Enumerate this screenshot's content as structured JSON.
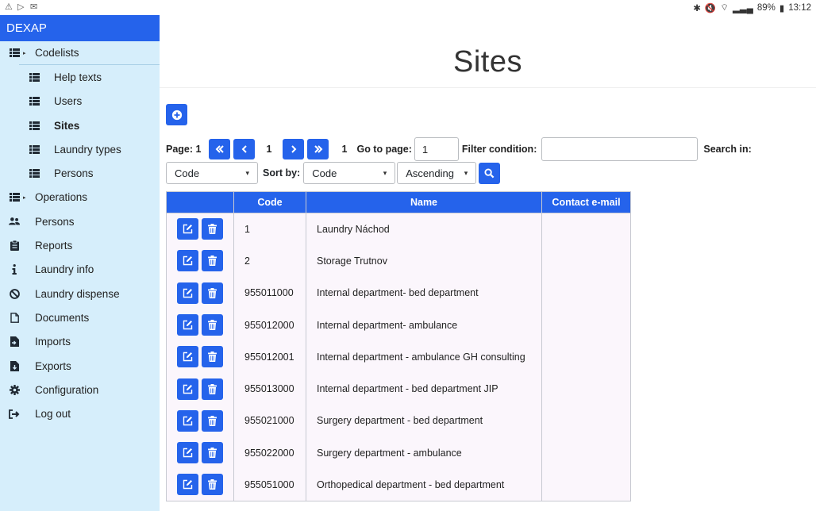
{
  "status": {
    "battery": "89%",
    "time": "13:12"
  },
  "app": {
    "brand": "DEXAP",
    "page_title": "Sites"
  },
  "sidebar": {
    "items": [
      {
        "label": "Codelists",
        "icon": "list-icon",
        "level": 0,
        "caret": true
      },
      {
        "label": "Help texts",
        "icon": "list-icon",
        "level": 1
      },
      {
        "label": "Users",
        "icon": "list-icon",
        "level": 1
      },
      {
        "label": "Sites",
        "icon": "list-icon",
        "level": 1,
        "active": true
      },
      {
        "label": "Laundry types",
        "icon": "list-icon",
        "level": 1
      },
      {
        "label": "Persons",
        "icon": "list-icon",
        "level": 1
      },
      {
        "label": "Operations",
        "icon": "list-icon",
        "level": 0,
        "caret": true
      },
      {
        "label": "Persons",
        "icon": "users-icon",
        "level": 0
      },
      {
        "label": "Reports",
        "icon": "clipboard-icon",
        "level": 0
      },
      {
        "label": "Laundry info",
        "icon": "info-icon",
        "level": 0
      },
      {
        "label": "Laundry dispense",
        "icon": "ban-icon",
        "level": 0
      },
      {
        "label": "Documents",
        "icon": "file-icon",
        "level": 0
      },
      {
        "label": "Imports",
        "icon": "file-import-icon",
        "level": 0
      },
      {
        "label": "Exports",
        "icon": "file-export-icon",
        "level": 0
      },
      {
        "label": "Configuration",
        "icon": "gear-icon",
        "level": 0
      },
      {
        "label": "Log out",
        "icon": "sign-out-icon",
        "level": 0
      }
    ]
  },
  "pager": {
    "page_label": "Page: 1",
    "current_page": "1",
    "total_pages": "1",
    "goto_label": "Go to page:",
    "goto_value": "1",
    "filter_label": "Filter condition:",
    "filter_value": "",
    "search_in_label": "Search in:",
    "search_in_value": "Code",
    "sort_by_label": "Sort by:",
    "sort_by_value": "Code",
    "order_value": "Ascending"
  },
  "table": {
    "headers": [
      "",
      "Code",
      "Name",
      "Contact e-mail"
    ],
    "rows": [
      {
        "code": "1",
        "name": "Laundry Náchod",
        "email": ""
      },
      {
        "code": "2",
        "name": "Storage Trutnov",
        "email": ""
      },
      {
        "code": "955011000",
        "name": "Internal department- bed department",
        "email": ""
      },
      {
        "code": "955012000",
        "name": "Internal department- ambulance",
        "email": ""
      },
      {
        "code": "955012001",
        "name": "Internal department - ambulance GH consulting",
        "email": ""
      },
      {
        "code": "955013000",
        "name": "Internal department - bed department JIP",
        "email": ""
      },
      {
        "code": "955021000",
        "name": "Surgery department - bed department",
        "email": ""
      },
      {
        "code": "955022000",
        "name": "Surgery department - ambulance",
        "email": ""
      },
      {
        "code": "955051000",
        "name": "Orthopedical department - bed department",
        "email": ""
      }
    ]
  },
  "colors": {
    "primary": "#2563eb",
    "sidebar_bg": "#d6eefb",
    "row_bg": "#fbf6fc"
  }
}
